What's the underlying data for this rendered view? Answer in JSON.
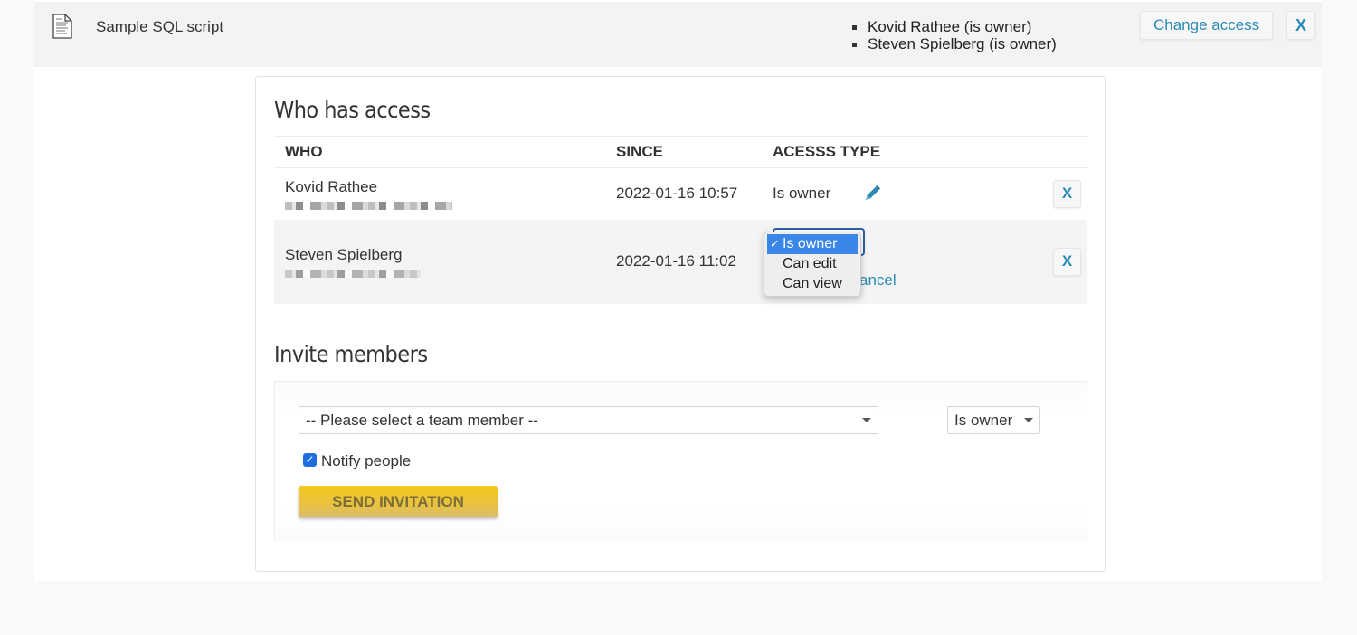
{
  "file": {
    "icon": "document-icon",
    "name": "Sample SQL script",
    "owners": [
      "Kovid Rathee (is owner)",
      "Steven Spielberg (is owner)"
    ],
    "change_access_label": "Change access",
    "close_label": "X"
  },
  "who_has_access": {
    "title": "Who has access",
    "columns": [
      "WHO",
      "SINCE",
      "ACESSS TYPE"
    ],
    "rows": [
      {
        "name": "Kovid Rathee",
        "email": "[redacted]",
        "since": "2022-01-16 10:57",
        "access_type": "Is owner",
        "edit_icon": "pencil-icon",
        "remove_label": "X"
      },
      {
        "name": "Steven Spielberg",
        "email": "[redacted]",
        "since": "2022-01-16 11:02",
        "access_type": "Is owner",
        "cancel_label": "Cancel",
        "cancel_visible": "ancel",
        "remove_label": "X",
        "dropdown_open": true,
        "dropdown_options": [
          {
            "label": "Is owner",
            "selected": true
          },
          {
            "label": "Can edit",
            "selected": false
          },
          {
            "label": "Can view",
            "selected": false
          }
        ]
      }
    ]
  },
  "invite": {
    "title": "Invite members",
    "member_select_value": "-- Please select a team member --",
    "role_select_value": "Is owner",
    "notify_label": "Notify people",
    "notify_checked": true,
    "send_label": "SEND INVITATION"
  },
  "colors": {
    "accent": "#2a8ab5",
    "send_button": "#f4c81a",
    "dropdown_selected": "#3a86e8"
  }
}
